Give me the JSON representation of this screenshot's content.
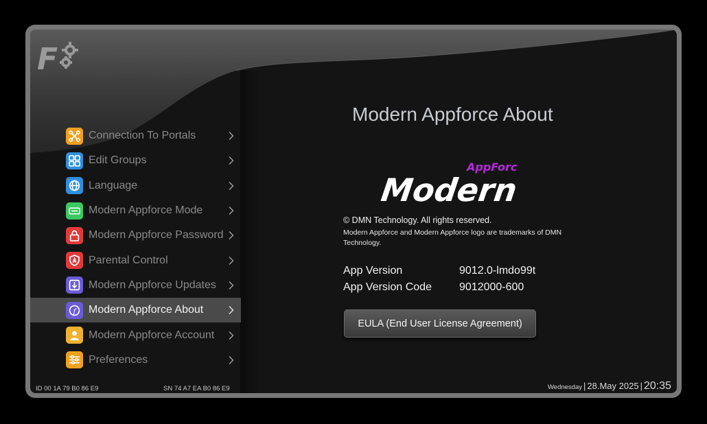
{
  "colors": {
    "accent": "#b22ad8",
    "selected_bg": "#4a4a4a"
  },
  "logo": {
    "letter": "F",
    "icon": "gear-icon"
  },
  "menu": {
    "items": [
      {
        "label": "Connection To Portals",
        "icon": "network-icon",
        "color": "#f0a020"
      },
      {
        "label": "Edit Groups",
        "icon": "groups-icon",
        "color": "#2f8fe0"
      },
      {
        "label": "Language",
        "icon": "globe-icon",
        "color": "#2f8fe0"
      },
      {
        "label": "Modern Appforce Mode",
        "icon": "mode-icon",
        "color": "#3cc860"
      },
      {
        "label": "Modern Appforce Password",
        "icon": "lock-icon",
        "color": "#e23a3a"
      },
      {
        "label": "Parental Control",
        "icon": "shield-icon",
        "color": "#e23a3a"
      },
      {
        "label": "Modern Appforce Updates",
        "icon": "download-icon",
        "color": "#6b5bd6"
      },
      {
        "label": "Modern Appforce About",
        "icon": "info-icon",
        "color": "#6b5bd6",
        "selected": true
      },
      {
        "label": "Modern Appforce Account",
        "icon": "user-icon",
        "color": "#f0b030"
      },
      {
        "label": "Preferences",
        "icon": "sliders-icon",
        "color": "#f0a020"
      }
    ]
  },
  "device": {
    "id": "ID  00 1A 79 B0 86 E9",
    "sn": "SN  74 A7 EA B0 86 E9"
  },
  "about": {
    "title": "Modern Appforce About",
    "brand_main": "Modern",
    "brand_sub": "AppForce",
    "copyright": "© DMN Technology. All rights reserved.",
    "trademark": "Modern Appforce and Modern Appforce logo are trademarks of DMN Technology.",
    "app_version_label": "App Version",
    "app_version_value": "9012.0-lmdo99t",
    "app_version_code_label": "App Version Code",
    "app_version_code_value": "9012000-600",
    "eula_label": "EULA (End User License Agreement)"
  },
  "status": {
    "day": "Wednesday",
    "separator": "|",
    "date": "28.May 2025",
    "time": "20:35"
  }
}
